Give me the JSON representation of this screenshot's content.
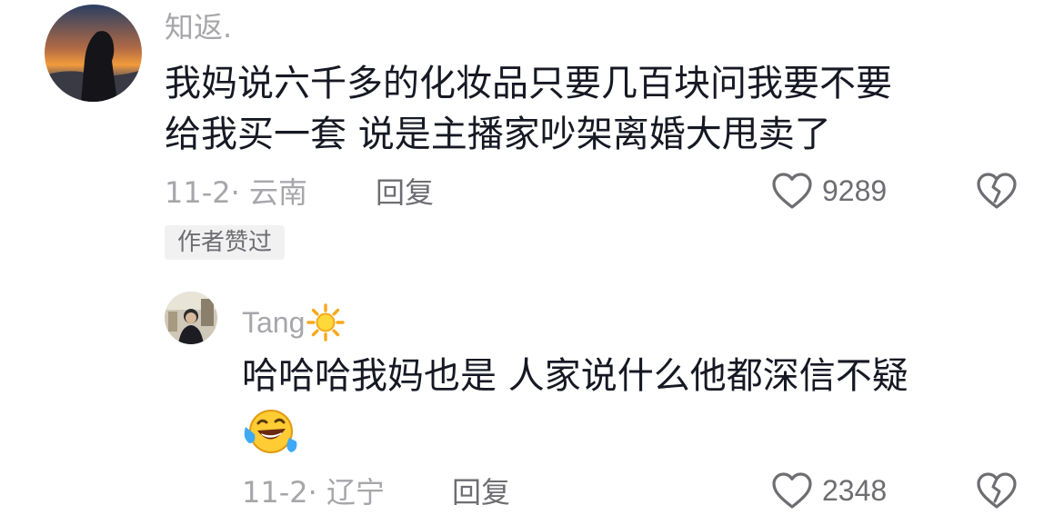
{
  "comments": [
    {
      "username": "知返.",
      "lines": [
        "我妈说六千多的化妆品只要几百块问我要不要",
        "给我买一套  说是主播家吵架离婚大甩卖了"
      ],
      "date_location": "11-2· 云南",
      "reply_label": "回复",
      "like_count": "9289",
      "badge": "作者赞过"
    }
  ],
  "replies": [
    {
      "username": "Tang",
      "username_emoji": "sun-emoji",
      "text": "哈哈哈我妈也是 人家说什么他都深信不疑",
      "emoji": "laughing-tears-emoji",
      "date_location": "11-2· 辽宁",
      "reply_label": "回复",
      "like_count": "2348"
    }
  ]
}
